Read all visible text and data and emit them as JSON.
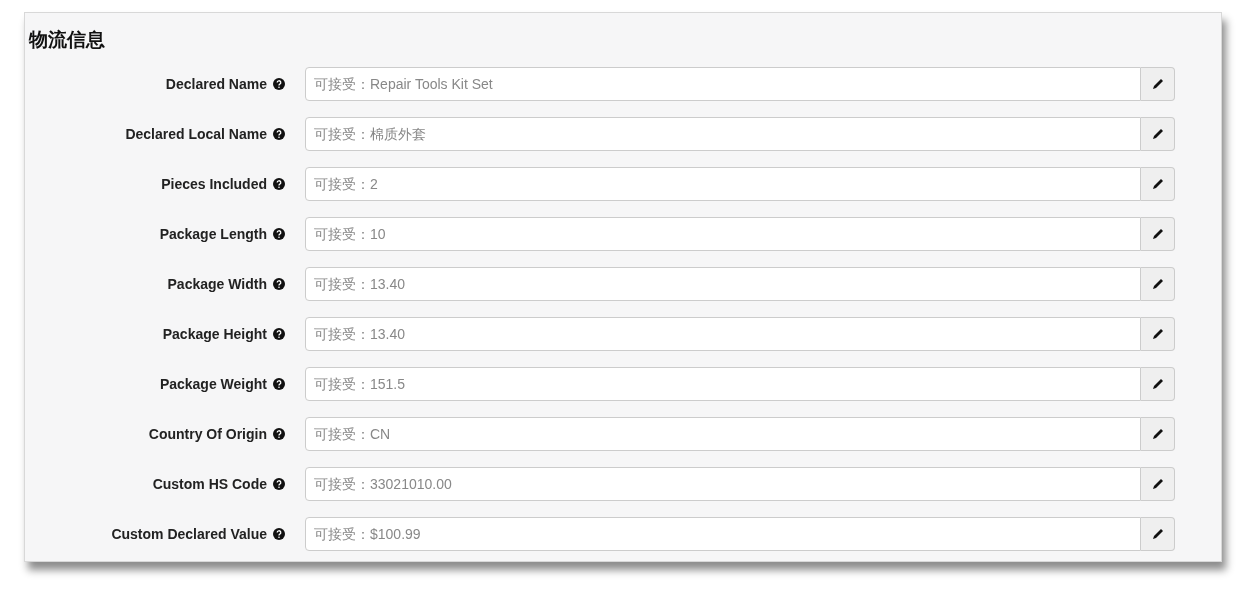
{
  "title": "物流信息",
  "fields": [
    {
      "label": "Declared Name",
      "placeholder": "可接受：Repair Tools Kit Set"
    },
    {
      "label": "Declared Local Name",
      "placeholder": "可接受：棉质外套"
    },
    {
      "label": "Pieces Included",
      "placeholder": "可接受：2"
    },
    {
      "label": "Package Length",
      "placeholder": "可接受：10"
    },
    {
      "label": "Package Width",
      "placeholder": "可接受：13.40"
    },
    {
      "label": "Package Height",
      "placeholder": "可接受：13.40"
    },
    {
      "label": "Package Weight",
      "placeholder": "可接受：151.5"
    },
    {
      "label": "Country Of Origin",
      "placeholder": "可接受：CN"
    },
    {
      "label": "Custom HS Code",
      "placeholder": "可接受：33021010.00"
    },
    {
      "label": "Custom Declared Value",
      "placeholder": "可接受：$100.99"
    }
  ]
}
